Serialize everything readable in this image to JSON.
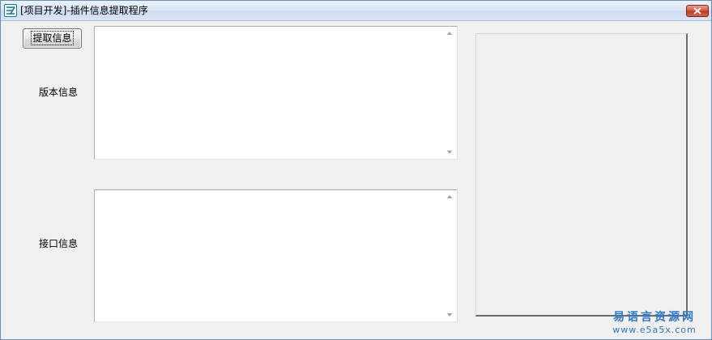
{
  "window": {
    "title": "[项目开发]-插件信息提取程序",
    "app_icon": "app-logo-icon",
    "close_icon": "close-icon"
  },
  "toolbar": {
    "extract_label": "提取信息"
  },
  "fields": {
    "version_label": "版本信息",
    "version_value": "",
    "interface_label": "接口信息",
    "interface_value": ""
  },
  "watermark": {
    "name": "易语言资源网",
    "url": "www.e5a5x.com"
  },
  "colors": {
    "close_button": "#c0381e",
    "watermark": "#2b79d2"
  }
}
